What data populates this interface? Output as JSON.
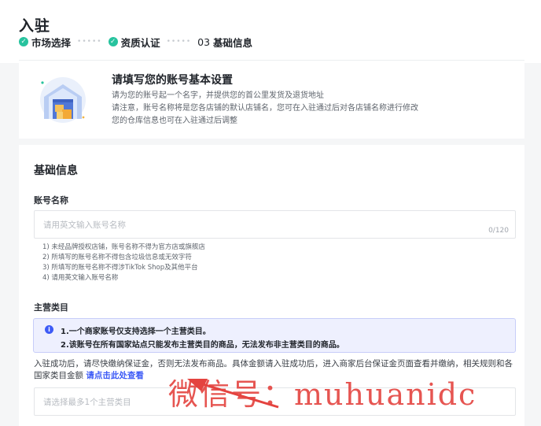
{
  "header": {
    "title": "入驻"
  },
  "steps": [
    {
      "label": "市场选择",
      "status": "done"
    },
    {
      "label": "资质认证",
      "status": "done"
    },
    {
      "num": "03",
      "label": "基础信息",
      "status": "current"
    }
  ],
  "intro": {
    "title": "请填写您的账号基本设置",
    "lines": [
      "请为您的账号起一个名字，并提供您的首公里发货及退货地址",
      "请注意，账号名称将是您各店铺的默认店铺名，您可在入驻通过后对各店铺名称进行修改",
      "您的仓库信息也可在入驻通过后调整"
    ]
  },
  "form": {
    "section_title": "基础信息",
    "account_name": {
      "label": "账号名称",
      "placeholder": "请用英文输入账号名称",
      "counter": "0/120",
      "rules": [
        "1) 未经品牌授权店铺，账号名称不得为官方店或旗舰店",
        "2) 所填写的账号名称不得包含垃圾信息或无效字符",
        "3) 所填写的账号名称不得涉TikTok Shop及其他平台",
        "4) 请用英文输入账号名称"
      ]
    },
    "main_category": {
      "label": "主营类目",
      "notice": [
        "1.一个商家账号仅支持选择一个主营类目。",
        "2.该账号在所有国家站点只能发布主营类目的商品，无法发布非主营类目的商品。"
      ],
      "deposit_text": "入驻成功后，请尽快缴纳保证金，否则无法发布商品。具体金额请入驻成功后，进入商家后台保证金页面查看并缴纳，相关规则和各国家类目金额 ",
      "deposit_link": "请点击此处查看",
      "placeholder": "请选择最多1个主营类目"
    }
  },
  "watermark": "微信号：muhuanidc",
  "colors": {
    "accent": "#3d5bf6",
    "success": "#27c39e",
    "watermark": "#e4433f"
  }
}
